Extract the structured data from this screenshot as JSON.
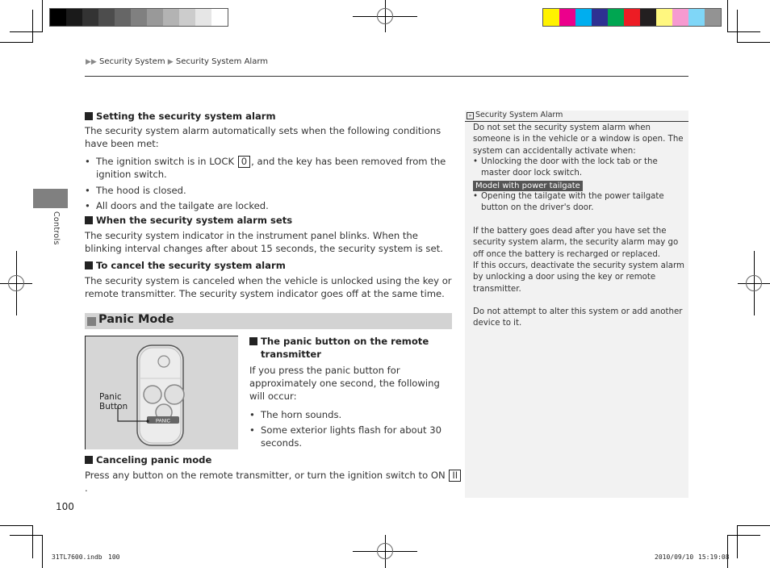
{
  "color_bars": {
    "grayscale": [
      "#000000",
      "#1a1a1a",
      "#333333",
      "#4d4d4d",
      "#666666",
      "#808080",
      "#999999",
      "#b3b3b3",
      "#cccccc",
      "#e6e6e6",
      "#ffffff"
    ],
    "process": [
      "#fff200",
      "#ec008c",
      "#00aeef",
      "#2e3192",
      "#00a651",
      "#ed1c24",
      "#231f20",
      "#fff77f",
      "#f69ad0",
      "#7fd6f7",
      "#939393"
    ]
  },
  "breadcrumb": {
    "arrow": "▶▶",
    "items": [
      "Security System",
      "Security System Alarm"
    ],
    "separator": "▶"
  },
  "side_tab": {
    "label": "Controls"
  },
  "sections": {
    "setting": {
      "heading": "Setting the security system alarm",
      "intro": "The security system alarm automatically sets when the following conditions have been met:",
      "bullets": [
        {
          "before": "The ignition switch is in LOCK ",
          "key": "0",
          "after": ", and the key has been removed from the ignition switch."
        },
        {
          "text": "The hood is closed."
        },
        {
          "text": "All doors and the tailgate are locked."
        }
      ]
    },
    "when_sets": {
      "heading": "When the security system alarm sets",
      "body": "The security system indicator in the instrument panel blinks. When the blinking interval changes after about 15 seconds, the security system is set."
    },
    "cancel": {
      "heading": "To cancel the security system alarm",
      "body": "The security system is canceled when the vehicle is unlocked using the key or remote transmitter. The security system indicator goes off at the same time."
    },
    "panic_mode": {
      "title": "Panic Mode",
      "figure": {
        "callout": "Panic Button",
        "button_label": "PANIC"
      },
      "remote": {
        "heading": "The panic button on the remote transmitter",
        "body": "If you press the panic button for approximately one second, the following will occur:",
        "bullets": [
          "The horn sounds.",
          "Some exterior lights flash for about 30 seconds."
        ]
      },
      "canceling": {
        "heading": "Canceling panic mode",
        "before": "Press any button on the remote transmitter, or turn the ignition switch to ON ",
        "key": "II",
        "after": "."
      }
    }
  },
  "side_panel": {
    "title": "Security System Alarm",
    "p1": "Do not set the security system alarm when someone is in the vehicle or a window is open. The system can accidentally activate when:",
    "bullet1": "Unlocking the door with the lock tab or the master door lock switch.",
    "badge": "Model with power tailgate",
    "bullet2": "Opening the tailgate with the power tailgate button on the driver's door.",
    "p2": "If the battery goes dead after you have set the security system alarm, the security alarm may go off once the battery is recharged or replaced.",
    "p3": "If this occurs, deactivate the security system alarm by unlocking a door using the key or remote transmitter.",
    "p4": "Do not attempt to alter this system or add another device to it."
  },
  "page_number": "100",
  "footer": {
    "file": "31TL7600.indb",
    "page": "100",
    "date": "2010/09/10",
    "time": "15:19:08"
  }
}
